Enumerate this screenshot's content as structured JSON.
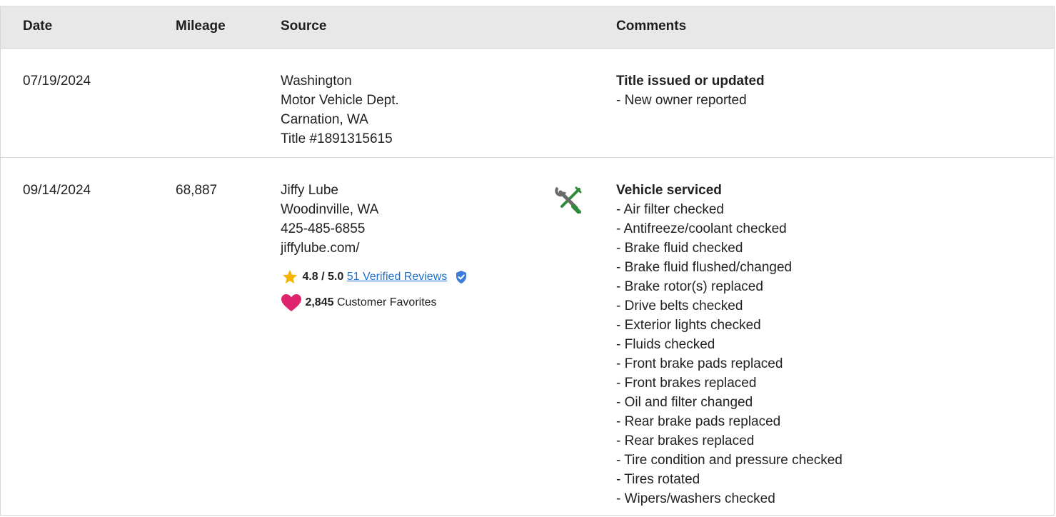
{
  "columns": {
    "date": "Date",
    "mileage": "Mileage",
    "source": "Source",
    "comments": "Comments"
  },
  "records": [
    {
      "date": "07/19/2024",
      "mileage": "",
      "source": [
        "Washington",
        "Motor Vehicle Dept.",
        "Carnation, WA",
        "Title #1891315615"
      ],
      "comment_title": "Title issued or updated",
      "comment_items": [
        "- New owner reported"
      ]
    },
    {
      "date": "09/14/2024",
      "mileage": "68,887",
      "source": [
        "Jiffy Lube",
        "Woodinville, WA",
        "425-485-6855",
        "jiffylube.com/"
      ],
      "rating": "4.8 / 5.0",
      "reviews_link": "51 Verified Reviews",
      "favorites_count": "2,845",
      "favorites_label": "Customer Favorites",
      "icon": "wrench-screwdriver-icon",
      "comment_title": "Vehicle serviced",
      "comment_items": [
        "- Air filter checked",
        "- Antifreeze/coolant checked",
        "- Brake fluid checked",
        "- Brake fluid flushed/changed",
        "- Brake rotor(s) replaced",
        "- Drive belts checked",
        "- Exterior lights checked",
        "- Fluids checked",
        "- Front brake pads replaced",
        "- Front brakes replaced",
        "- Oil and filter changed",
        "- Rear brake pads replaced",
        "- Rear brakes replaced",
        "- Tire condition and pressure checked",
        "- Tires rotated",
        "- Wipers/washers checked"
      ]
    }
  ],
  "colors": {
    "header_bg": "#e8e8e8",
    "link": "#1a6fd0",
    "star": "#f5b400",
    "heart": "#e0226e",
    "verified": "#3b7dd8",
    "wrench_green": "#2e8b3a"
  }
}
